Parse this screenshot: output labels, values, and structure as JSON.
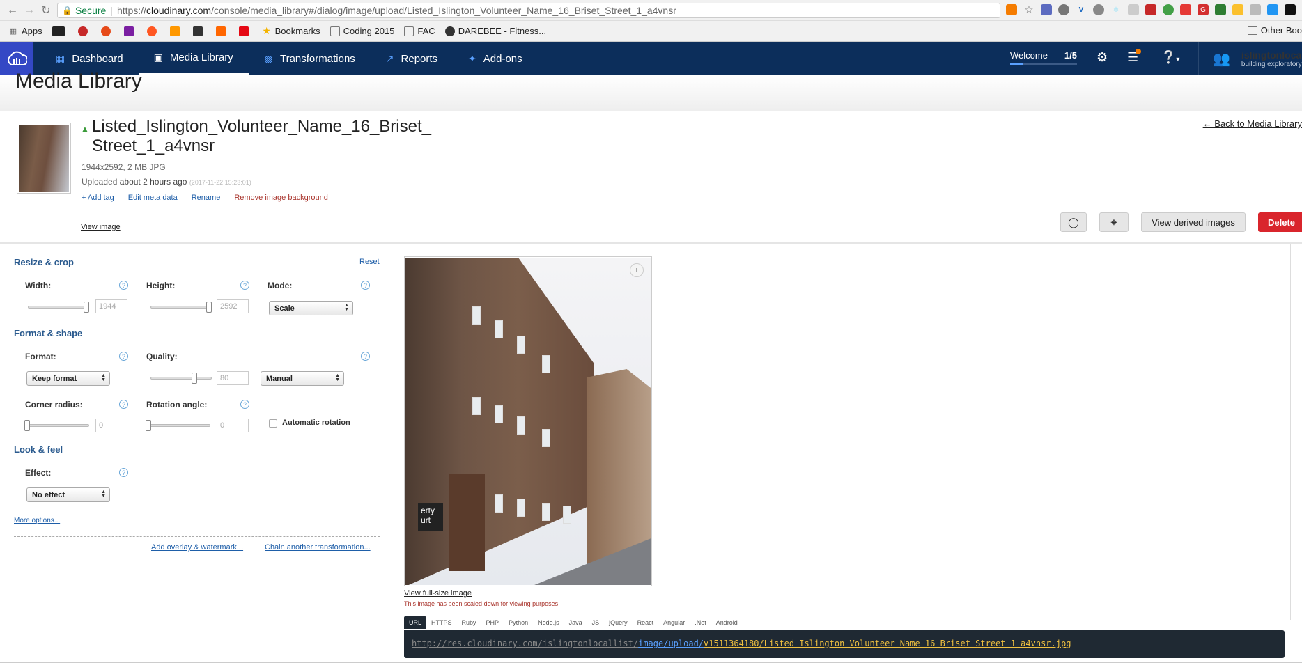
{
  "browser": {
    "secure_label": "Secure",
    "url_proto": "https://",
    "url_host": "cloudinary.com",
    "url_path": "/console/media_library#/dialog/image/upload/Listed_Islington_Volunteer_Name_16_Briset_Street_1_a4vnsr",
    "bookmarks": [
      "Apps",
      "Bookmarks",
      "Coding 2015",
      "FAC",
      "DAREBEE - Fitness..."
    ],
    "other_bookmarks": "Other Boo"
  },
  "nav": {
    "items": [
      "Dashboard",
      "Media Library",
      "Transformations",
      "Reports",
      "Add-ons"
    ],
    "welcome": "Welcome",
    "welcome_progress": "1/5",
    "user_name": "islingtonlocall...",
    "user_org": "building exploratory"
  },
  "page": {
    "title": "Media Library",
    "back_link": "← Back to Media Library"
  },
  "asset": {
    "title_line1": "Listed_Islington_Volunteer_Name_16_Briset_",
    "title_line2": "Street_1_a4vnsr",
    "meta": "1944x2592, 2 MB JPG",
    "uploaded_prefix": "Uploaded ",
    "uploaded_ago": "about 2 hours ago",
    "uploaded_ts": "(2017-11-22 15:23:01)",
    "actions": {
      "add_tag": "+ Add tag",
      "edit_meta": "Edit meta data",
      "rename": "Rename",
      "remove_bg": "Remove image background"
    },
    "view_image": "View image"
  },
  "toolbar": {
    "view_derived": "View derived images",
    "delete": "Delete"
  },
  "transform": {
    "resize_title": "Resize & crop",
    "reset": "Reset",
    "width_label": "Width:",
    "width_value": "1944",
    "height_label": "Height:",
    "height_value": "2592",
    "mode_label": "Mode:",
    "mode_value": "Scale",
    "format_title": "Format & shape",
    "format_label": "Format:",
    "format_value": "Keep format",
    "quality_label": "Quality:",
    "quality_value": "80",
    "quality_mode": "Manual",
    "corner_label": "Corner radius:",
    "corner_value": "0",
    "rotation_label": "Rotation angle:",
    "rotation_value": "0",
    "auto_rotation": "Automatic rotation",
    "look_title": "Look & feel",
    "effect_label": "Effect:",
    "effect_value": "No effect",
    "more_options": "More options...",
    "add_overlay": "Add overlay & watermark...",
    "chain": "Chain another transformation..."
  },
  "preview": {
    "full_size": "View full-size image",
    "scaled_note": "This image has been scaled down for viewing purposes",
    "sign_text": "erty\nurt",
    "code_tabs": [
      "URL",
      "HTTPS",
      "Ruby",
      "PHP",
      "Python",
      "Node.js",
      "Java",
      "JS",
      "jQuery",
      "React",
      "Angular",
      ".Net",
      "Android"
    ],
    "url_part1": "http://res.cloudinary.com/islingtonlocallist/",
    "url_part2": "image/upload/",
    "url_part3": "v1511364180/Listed_Islington_Volunteer_Name_16_Briset_Street_1_a4vnsr.jpg"
  },
  "colors": {
    "nav_bg": "#0c2e5b",
    "accent": "#3448c5",
    "delete": "#d9252c",
    "link": "#1e5ea8"
  }
}
